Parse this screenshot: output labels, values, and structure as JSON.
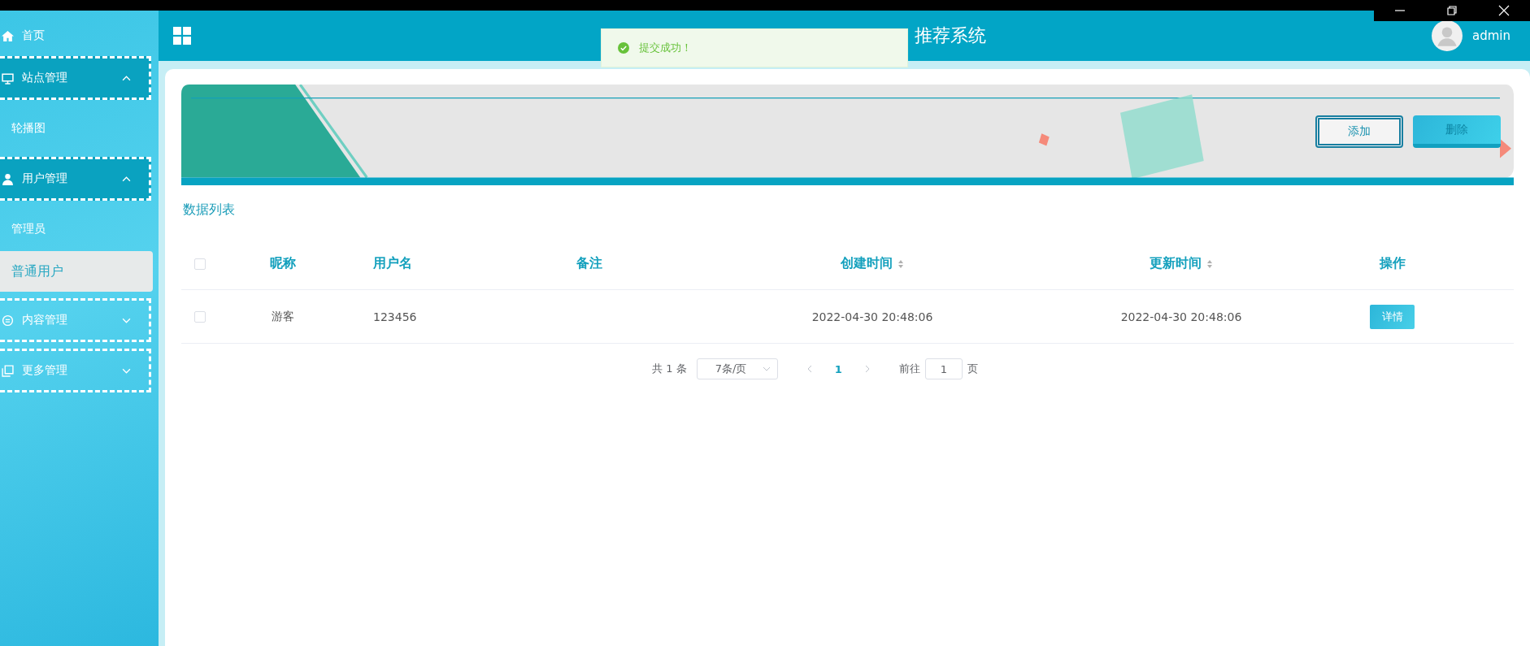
{
  "sidebar": {
    "items": [
      {
        "label": "首页",
        "kind": "link"
      },
      {
        "label": "站点管理",
        "kind": "group",
        "expanded": true,
        "children": [
          {
            "label": "轮播图",
            "selected": false
          }
        ]
      },
      {
        "label": "用户管理",
        "kind": "group",
        "expanded": true,
        "children": [
          {
            "label": "管理员",
            "selected": false
          },
          {
            "label": "普通用户",
            "selected": true
          }
        ]
      },
      {
        "label": "内容管理",
        "kind": "group",
        "expanded": false
      },
      {
        "label": "更多管理",
        "kind": "group",
        "expanded": false
      }
    ]
  },
  "header": {
    "title": "推荐系统",
    "user": "admin"
  },
  "toast": {
    "message": "提交成功！"
  },
  "toolbar": {
    "buttons": [
      {
        "label": "添加",
        "kind": "outline"
      },
      {
        "label": "删除",
        "kind": "filled"
      }
    ]
  },
  "section_title": "数据列表",
  "table": {
    "select_all": false,
    "columns": [
      {
        "label": "昵称",
        "sortable": false
      },
      {
        "label": "用户名",
        "sortable": false
      },
      {
        "label": "备注",
        "sortable": false
      },
      {
        "label": "创建时间",
        "sortable": true
      },
      {
        "label": "更新时间",
        "sortable": true
      },
      {
        "label": "操作",
        "sortable": false
      }
    ],
    "rows": [
      {
        "checked": false,
        "nickname": "游客",
        "username": "123456",
        "created": "2022-04-30 20:48:06",
        "updated": "2022-04-30 20:48:06",
        "action": "详情"
      }
    ]
  },
  "pagination": {
    "total": "共 1 条",
    "page_size": "7条/页",
    "pages": [
      {
        "label": "1",
        "selected": true
      }
    ],
    "goto_label": "前往",
    "goto_value": "1",
    "goto_suffix": "页"
  }
}
